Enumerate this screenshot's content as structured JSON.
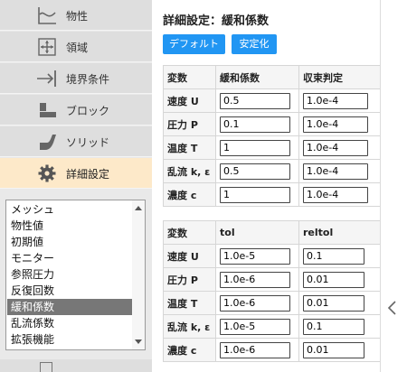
{
  "sidebar": {
    "items": [
      {
        "label": "物性",
        "icon": "curve-graph-icon"
      },
      {
        "label": "領域",
        "icon": "move-arrows-icon"
      },
      {
        "label": "境界条件",
        "icon": "arrow-to-wall-icon"
      },
      {
        "label": "ブロック",
        "icon": "block-icon"
      },
      {
        "label": "ソリッド",
        "icon": "solid-shape-icon"
      },
      {
        "label": "詳細設定",
        "icon": "gear-icon",
        "active": true
      }
    ],
    "list": {
      "items": [
        "メッシュ",
        "物性値",
        "初期値",
        "モニター",
        "参照圧力",
        "反復回数",
        "緩和係数",
        "乱流係数",
        "拡張機能"
      ],
      "selected": "緩和係数"
    }
  },
  "main": {
    "title": "詳細設定：緩和係数",
    "buttons": {
      "default": "デフォルト",
      "stabilize": "安定化"
    },
    "relax_table": {
      "headers": [
        "変数",
        "緩和係数",
        "収束判定"
      ],
      "rows": [
        {
          "var": "速度 U",
          "relax": "0.5",
          "conv": "1.0e-4"
        },
        {
          "var": "圧力 P",
          "relax": "0.1",
          "conv": "1.0e-4"
        },
        {
          "var": "温度 T",
          "relax": "1",
          "conv": "1.0e-4"
        },
        {
          "var": "乱流 k, ε",
          "relax": "0.5",
          "conv": "1.0e-4"
        },
        {
          "var": "濃度 c",
          "relax": "1",
          "conv": "1.0e-4"
        }
      ]
    },
    "tol_table": {
      "headers": [
        "変数",
        "tol",
        "reltol"
      ],
      "rows": [
        {
          "var": "速度 U",
          "tol": "1.0e-5",
          "reltol": "0.1"
        },
        {
          "var": "圧力 P",
          "tol": "1.0e-6",
          "reltol": "0.01"
        },
        {
          "var": "温度 T",
          "tol": "1.0e-6",
          "reltol": "0.01"
        },
        {
          "var": "乱流 k, ε",
          "tol": "1.0e-5",
          "reltol": "0.1"
        },
        {
          "var": "濃度 c",
          "tol": "1.0e-6",
          "reltol": "0.01"
        }
      ]
    }
  },
  "colors": {
    "accent": "#2196f3",
    "active_nav": "#fde9c9",
    "selected_list": "#777777"
  }
}
